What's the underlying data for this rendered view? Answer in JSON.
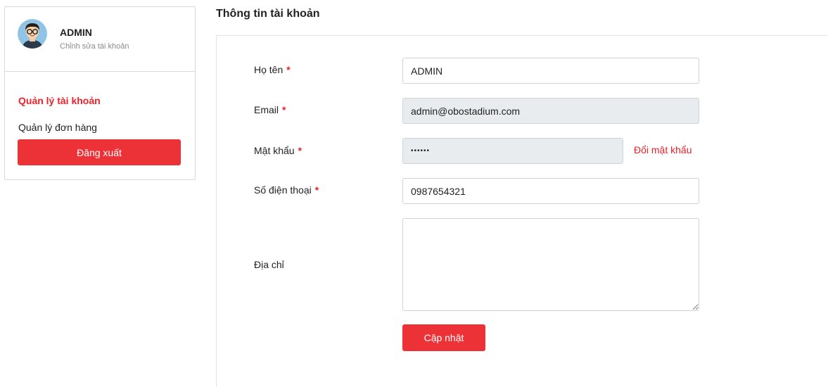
{
  "sidebar": {
    "user_name": "ADMIN",
    "edit_account": "Chỉnh sửa tài khoản",
    "menu": [
      {
        "label": "Quản lý tài khoản",
        "active": true
      },
      {
        "label": "Quản lý đơn hàng",
        "active": false
      }
    ],
    "logout_label": "Đăng xuất"
  },
  "main": {
    "title": "Thông tin tài khoản",
    "required_mark": "*",
    "fields": {
      "fullname": {
        "label": "Họ tên",
        "value": "ADMIN"
      },
      "email": {
        "label": "Email",
        "value": "admin@obostadium.com"
      },
      "password": {
        "label": "Mật khẩu",
        "value": "••••••",
        "change_label": "Đổi mật khẩu"
      },
      "phone": {
        "label": "Số điện thoại",
        "value": "0987654321"
      },
      "address": {
        "label": "Địa chỉ",
        "value": ""
      }
    },
    "submit_label": "Cập nhật"
  },
  "colors": {
    "accent": "#ec3237",
    "active_text": "#e8232a",
    "disabled_bg": "#e9ecef"
  },
  "icons": {
    "avatar": "avatar-person-glasses"
  }
}
